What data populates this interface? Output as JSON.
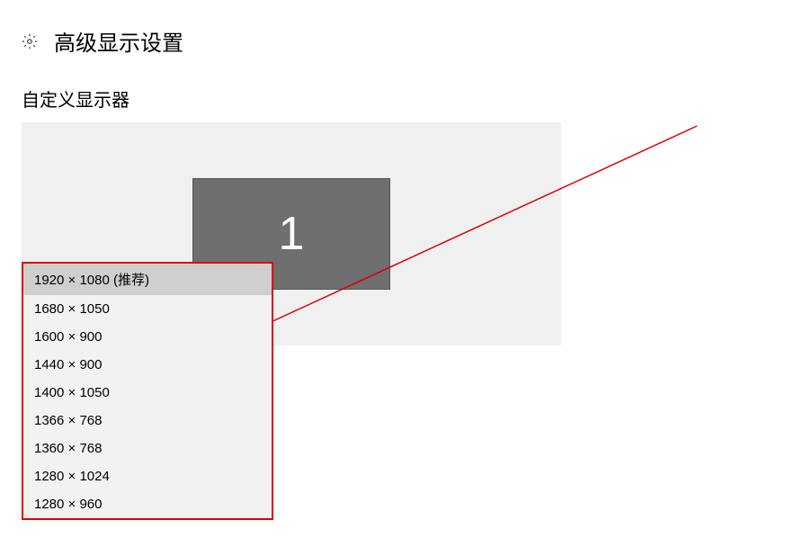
{
  "header": {
    "title": "高级显示设置"
  },
  "section": {
    "customize_title": "自定义显示器"
  },
  "monitor": {
    "number": "1"
  },
  "resolution_options": [
    {
      "label": "1920 × 1080 (推荐)",
      "selected": true
    },
    {
      "label": "1680 × 1050",
      "selected": false
    },
    {
      "label": "1600 × 900",
      "selected": false
    },
    {
      "label": "1440 × 900",
      "selected": false
    },
    {
      "label": "1400 × 1050",
      "selected": false
    },
    {
      "label": "1366 × 768",
      "selected": false
    },
    {
      "label": "1360 × 768",
      "selected": false
    },
    {
      "label": "1280 × 1024",
      "selected": false
    },
    {
      "label": "1280 × 960",
      "selected": false
    }
  ],
  "annotation": {
    "arrow_color": "#e00000"
  }
}
